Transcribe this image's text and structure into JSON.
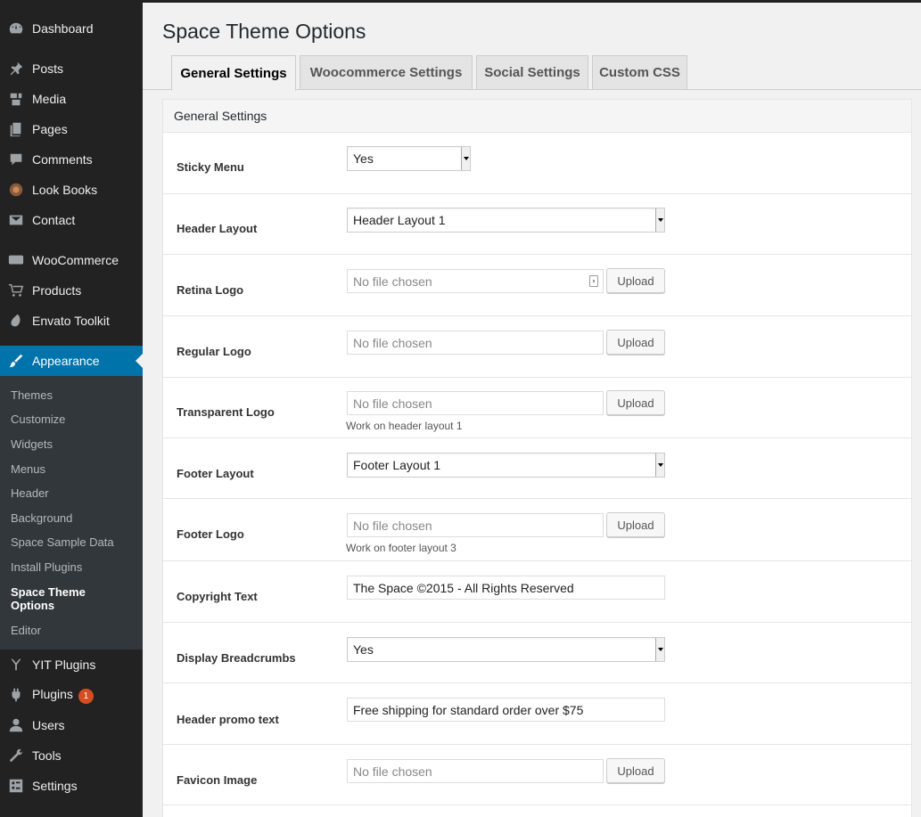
{
  "sidebar": {
    "items": [
      {
        "label": "Dashboard",
        "icon": "dashboard-icon"
      },
      {
        "label": "Posts",
        "icon": "pin-icon"
      },
      {
        "label": "Media",
        "icon": "media-icon"
      },
      {
        "label": "Pages",
        "icon": "pages-icon"
      },
      {
        "label": "Comments",
        "icon": "comments-icon"
      },
      {
        "label": "Look Books",
        "icon": "lookbooks-icon"
      },
      {
        "label": "Contact",
        "icon": "mail-icon"
      },
      {
        "label": "WooCommerce",
        "icon": "woo-icon"
      },
      {
        "label": "Products",
        "icon": "cart-icon"
      },
      {
        "label": "Envato Toolkit",
        "icon": "leaf-icon"
      },
      {
        "label": "Appearance",
        "icon": "brush-icon"
      },
      {
        "label": "YIT Plugins",
        "icon": "yit-icon"
      },
      {
        "label": "Plugins",
        "icon": "plugin-icon",
        "badge": "1"
      },
      {
        "label": "Users",
        "icon": "user-icon"
      },
      {
        "label": "Tools",
        "icon": "wrench-icon"
      },
      {
        "label": "Settings",
        "icon": "settings-icon"
      }
    ],
    "submenu": [
      "Themes",
      "Customize",
      "Widgets",
      "Menus",
      "Header",
      "Background",
      "Space Sample Data",
      "Install Plugins",
      "Space Theme Options",
      "Editor"
    ]
  },
  "page": {
    "title": "Space Theme Options",
    "tabs": [
      "General Settings",
      "Woocommerce Settings",
      "Social Settings",
      "Custom CSS"
    ],
    "section_title": "General Settings"
  },
  "fields": {
    "sticky_menu": {
      "label": "Sticky Menu",
      "value": "Yes"
    },
    "header_layout": {
      "label": "Header Layout",
      "value": "Header Layout 1"
    },
    "retina_logo": {
      "label": "Retina Logo",
      "placeholder": "No file chosen",
      "button": "Upload"
    },
    "regular_logo": {
      "label": "Regular Logo",
      "placeholder": "No file chosen",
      "button": "Upload"
    },
    "transparent_logo": {
      "label": "Transparent Logo",
      "placeholder": "No file chosen",
      "button": "Upload",
      "help": "Work on header layout 1"
    },
    "footer_layout": {
      "label": "Footer Layout",
      "value": "Footer Layout 1"
    },
    "footer_logo": {
      "label": "Footer Logo",
      "placeholder": "No file chosen",
      "button": "Upload",
      "help": "Work on footer layout 3"
    },
    "copyright_text": {
      "label": "Copyright Text",
      "value": "The Space ©2015 - All Rights Reserved"
    },
    "display_breadcrumbs": {
      "label": "Display Breadcrumbs",
      "value": "Yes"
    },
    "header_promo_text": {
      "label": "Header promo text",
      "value": "Free shipping for standard order over $75"
    },
    "favicon_image": {
      "label": "Favicon Image",
      "placeholder": "No file chosen",
      "button": "Upload"
    }
  },
  "colors": {
    "sidebar_bg": "#222222",
    "submenu_bg": "#32373c",
    "accent": "#0073aa",
    "badge": "#d54e21"
  }
}
